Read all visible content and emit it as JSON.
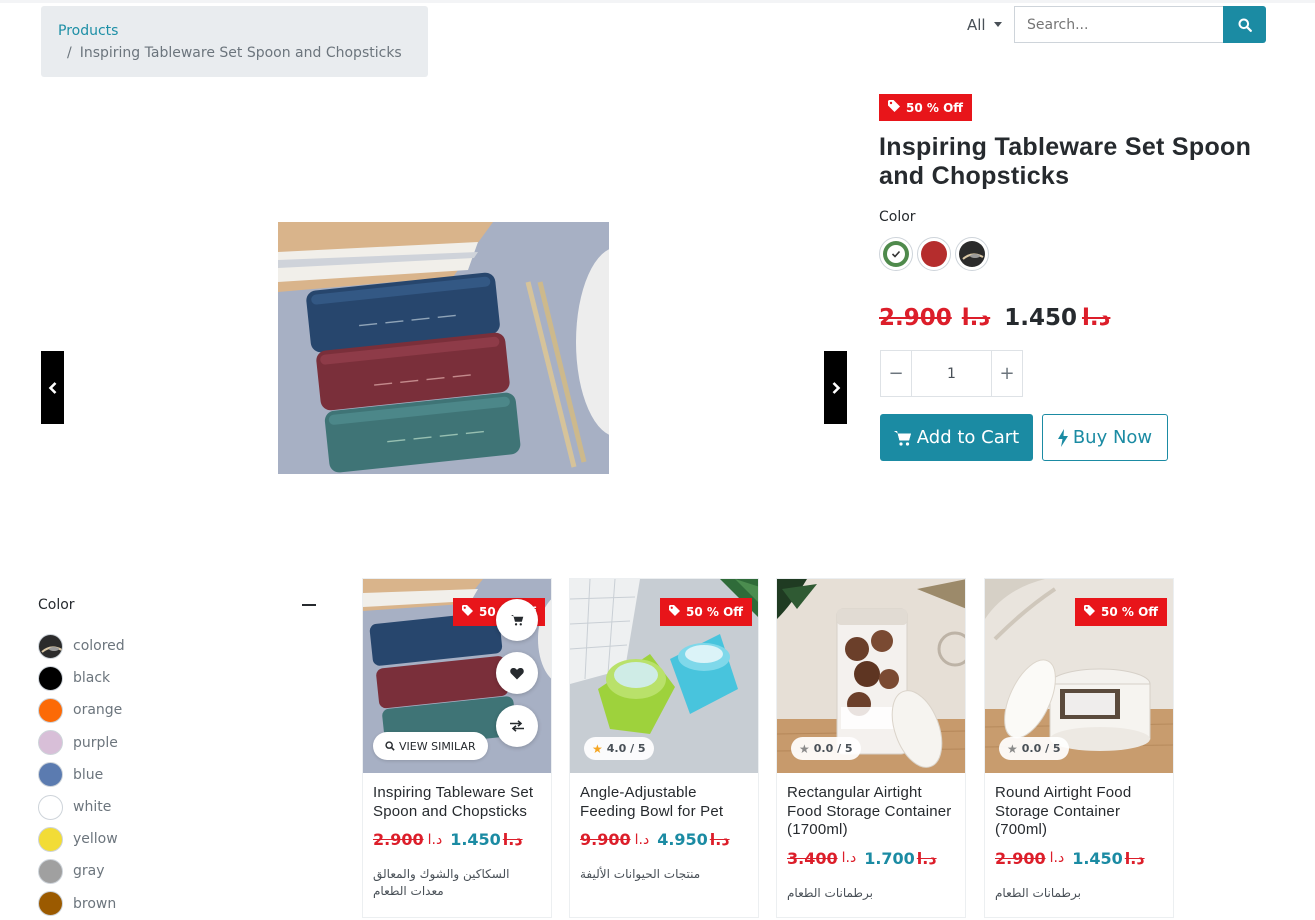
{
  "breadcrumb": {
    "parent": "Products",
    "separator": "/",
    "current": "Inspiring Tableware Set Spoon and Chopsticks"
  },
  "search": {
    "filter_label": "All",
    "placeholder": "Search...",
    "button_icon": "search-icon"
  },
  "product": {
    "discount_badge": "50 % Off",
    "title": "Inspiring Tableware Set Spoon and Chopsticks",
    "color_label": "Color",
    "swatches": [
      {
        "name": "green",
        "color": "#4f8a4c",
        "selected": true
      },
      {
        "name": "red",
        "color": "#b52d2d",
        "selected": false
      },
      {
        "name": "colored",
        "color": "#2b2b2b",
        "selected": false
      }
    ],
    "old_price": "2.900",
    "old_currency": "د.ا",
    "new_price": "1.450",
    "new_currency": "د.ا",
    "quantity": "1",
    "qty_minus": "−",
    "qty_plus": "+",
    "add_to_cart": "Add to Cart",
    "buy_now": "Buy Now"
  },
  "filters": {
    "title": "Color",
    "colors": [
      {
        "name": "colored",
        "color": "#2b2b2b"
      },
      {
        "name": "black",
        "color": "#000000"
      },
      {
        "name": "orange",
        "color": "#fc6a06"
      },
      {
        "name": "purple",
        "color": "#d8bfd8"
      },
      {
        "name": "blue",
        "color": "#5b7bb0"
      },
      {
        "name": "white",
        "color": "#ffffff"
      },
      {
        "name": "yellow",
        "color": "#f2dc36"
      },
      {
        "name": "gray",
        "color": "#a0a0a0"
      },
      {
        "name": "brown",
        "color": "#9b5a00"
      }
    ]
  },
  "cards": [
    {
      "badge": "50 % Off",
      "rating": "",
      "title": "Inspiring Tableware Set Spoon and Chopsticks",
      "old_price": "2.900",
      "old_currency": "د.ا",
      "new_price": "1.450",
      "new_currency": "د.ا",
      "category_1": "السكاكين والشوك والمعالق",
      "category_2": "معدات الطعام",
      "view_similar": "VIEW SIMILAR"
    },
    {
      "badge": "50 % Off",
      "rating": "4.0 / 5",
      "title": "Angle-Adjustable Feeding Bowl for Pet",
      "old_price": "9.900",
      "old_currency": "د.ا",
      "new_price": "4.950",
      "new_currency": "د.ا",
      "category_1": "منتجات الحيوانات الأليفة",
      "category_2": ""
    },
    {
      "badge": "",
      "rating": "0.0 / 5",
      "title": "Rectangular Airtight Food Storage Container (1700ml)",
      "old_price": "3.400",
      "old_currency": "د.ا",
      "new_price": "1.700",
      "new_currency": "د.ا",
      "category_1": "برطمانات الطعام",
      "category_2": ""
    },
    {
      "badge": "50 % Off",
      "rating": "0.0 / 5",
      "title": "Round Airtight Food Storage Container (700ml)",
      "old_price": "2.900",
      "old_currency": "د.ا",
      "new_price": "1.450",
      "new_currency": "د.ا",
      "category_1": "برطمانات الطعام",
      "category_2": ""
    }
  ],
  "colors": {
    "accent": "#1b8ba3",
    "sale_red": "#e8151a",
    "dark": "#262a2e"
  }
}
